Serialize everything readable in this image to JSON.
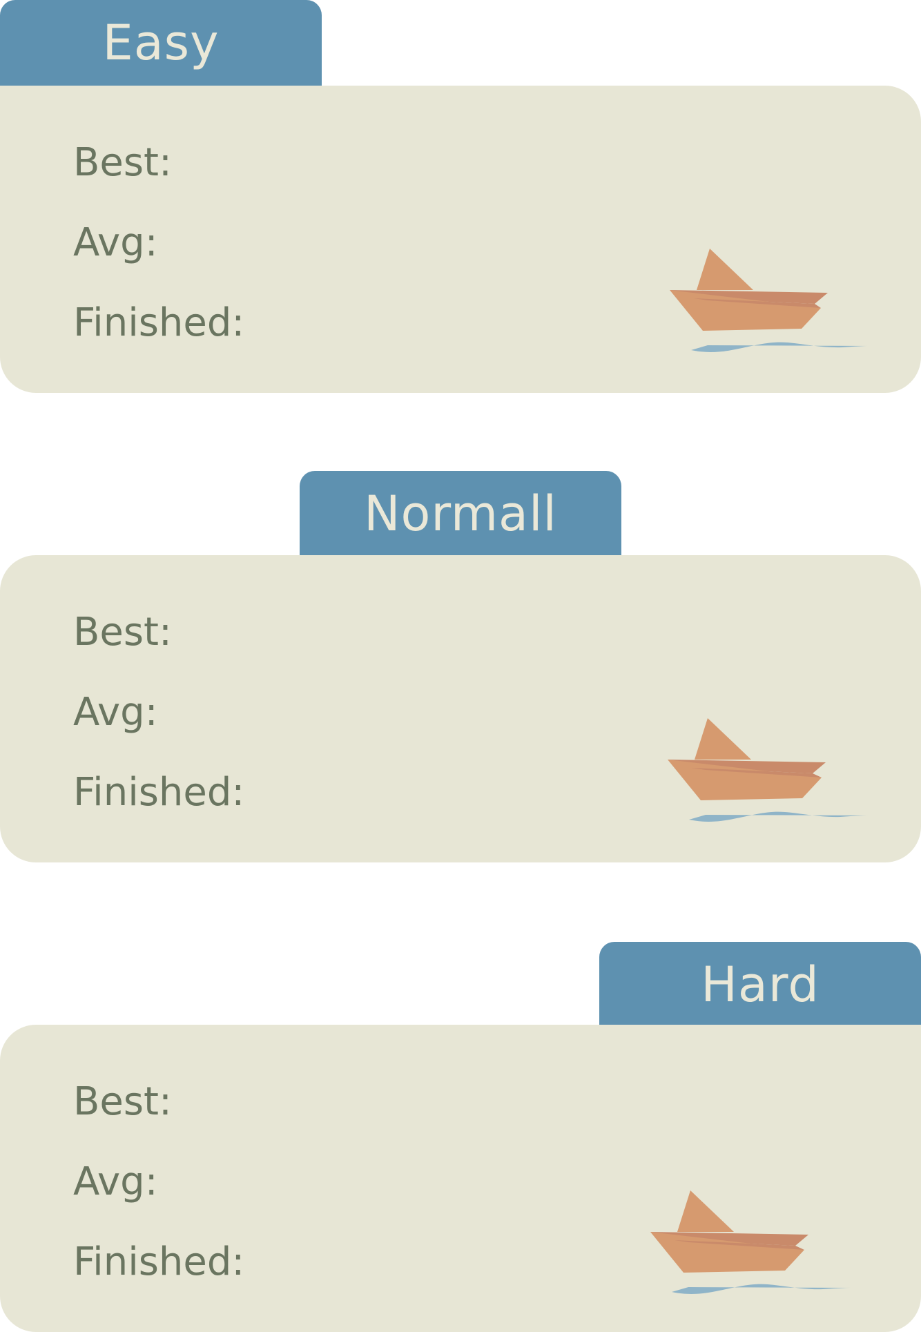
{
  "sections": [
    {
      "tab": "Easy",
      "labels": {
        "best": "Best:",
        "avg": "Avg:",
        "finished": "Finished:"
      },
      "icon": "paper-boat-icon"
    },
    {
      "tab": "Normall",
      "labels": {
        "best": "Best:",
        "avg": "Avg:",
        "finished": "Finished:"
      },
      "icon": "paper-boat-icon"
    },
    {
      "tab": "Hard",
      "labels": {
        "best": "Best:",
        "avg": "Avg:",
        "finished": "Finished:"
      },
      "icon": "paper-boat-icon"
    }
  ],
  "colors": {
    "tab": "#5e91b0",
    "tab_text": "#eae8d8",
    "card": "#e7e6d5",
    "label_text": "#6a7560",
    "boat": "#d69a6f",
    "boat_shade": "#c98a6a",
    "water": "#8fb4c8"
  }
}
